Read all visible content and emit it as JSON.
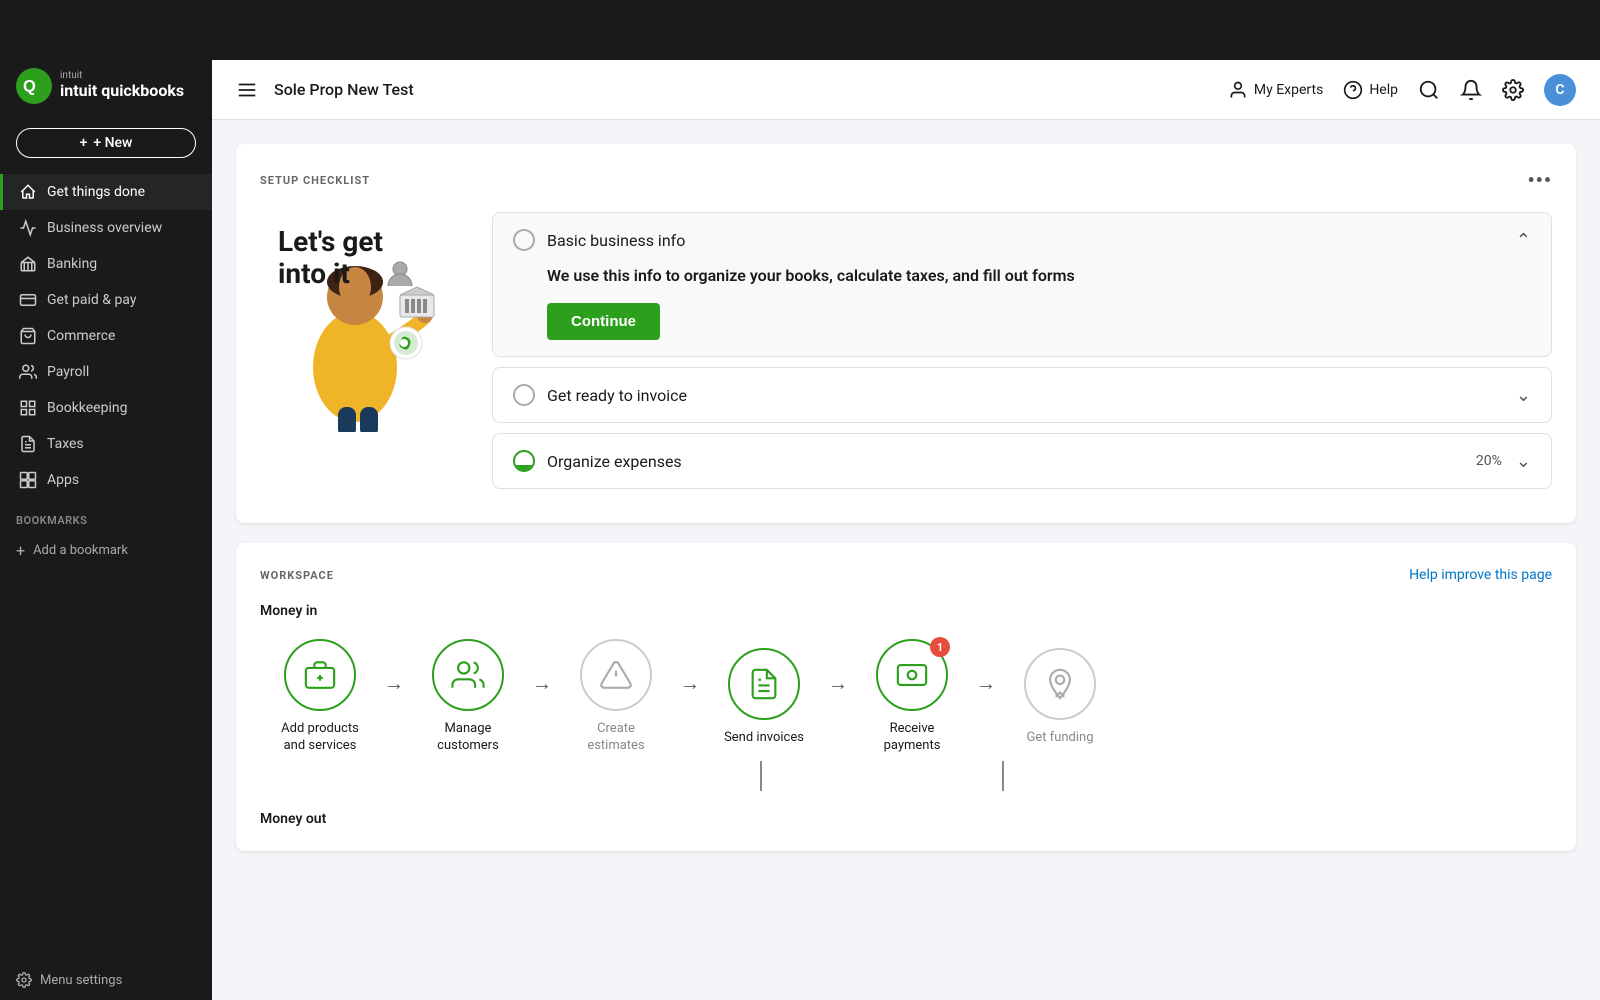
{
  "topbar": {
    "brand": "intuit quickbooks"
  },
  "header": {
    "menu_icon": "hamburger-icon",
    "title": "Sole Prop New Test",
    "my_experts_label": "My Experts",
    "help_label": "Help",
    "avatar_letter": "C"
  },
  "sidebar": {
    "new_button": "+ New",
    "nav_items": [
      {
        "id": "get-things-done",
        "label": "Get things done",
        "icon": "home-icon",
        "active": true
      },
      {
        "id": "business-overview",
        "label": "Business overview",
        "icon": "chart-icon",
        "active": false
      },
      {
        "id": "banking",
        "label": "Banking",
        "icon": "bank-icon",
        "active": false
      },
      {
        "id": "get-paid-pay",
        "label": "Get paid & pay",
        "icon": "money-icon",
        "active": false
      },
      {
        "id": "commerce",
        "label": "Commerce",
        "icon": "commerce-icon",
        "active": false
      },
      {
        "id": "payroll",
        "label": "Payroll",
        "icon": "payroll-icon",
        "active": false
      },
      {
        "id": "bookkeeping",
        "label": "Bookkeeping",
        "icon": "bookkeeping-icon",
        "active": false
      },
      {
        "id": "taxes",
        "label": "Taxes",
        "icon": "taxes-icon",
        "active": false
      },
      {
        "id": "apps",
        "label": "Apps",
        "icon": "apps-icon",
        "active": false
      }
    ],
    "bookmarks_section": "BOOKMARKS",
    "add_bookmark": "Add a bookmark",
    "menu_settings": "Menu settings"
  },
  "checklist": {
    "label": "SETUP CHECKLIST",
    "heading_line1": "Let's get",
    "heading_line2": "into it",
    "items": [
      {
        "id": "basic-business-info",
        "title": "Basic business info",
        "expanded": true,
        "desc": "We use this info to organize your books, calculate taxes, and fill out forms",
        "button_label": "Continue",
        "percent": null
      },
      {
        "id": "get-ready-invoice",
        "title": "Get ready to invoice",
        "expanded": false,
        "desc": "",
        "button_label": "",
        "percent": null
      },
      {
        "id": "organize-expenses",
        "title": "Organize expenses",
        "expanded": false,
        "desc": "",
        "button_label": "",
        "percent": "20%"
      }
    ]
  },
  "workspace": {
    "label": "WORKSPACE",
    "help_link": "Help improve this page",
    "money_in_label": "Money in",
    "workflow_items": [
      {
        "id": "add-products",
        "label": "Add products\nand services",
        "active": true,
        "badge": null
      },
      {
        "id": "manage-customers",
        "label": "Manage customers",
        "active": true,
        "badge": null
      },
      {
        "id": "create-estimates",
        "label": "Create estimates",
        "active": false,
        "badge": null
      },
      {
        "id": "send-invoices",
        "label": "Send invoices",
        "active": true,
        "badge": null
      },
      {
        "id": "receive-payments",
        "label": "Receive payments",
        "active": true,
        "badge": "1"
      },
      {
        "id": "get-funding",
        "label": "Get funding",
        "active": false,
        "badge": null
      }
    ],
    "money_out_label": "Money out"
  }
}
